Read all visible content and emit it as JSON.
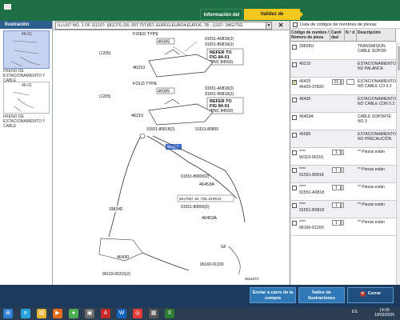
{
  "topbar": {
    "tab_info": "Información del",
    "tab_validity": "Validez de especificación"
  },
  "left": {
    "header": "Ilustración",
    "thumbs": [
      {
        "num": "46-01",
        "caption": "FRENO DE ESTACIONAMIENTO Y CABLE"
      },
      {
        "num": "46-01",
        "caption": "FRENO DE ESTACIONAMIENTO Y CABLE"
      }
    ]
  },
  "middle": {
    "caption": "ILLUST NO. 1 OF 2(1107- )[KZJ70,J20..65T,75T,85T..EURO3,EURO4,EURO6..TB ; (1107- )WG/70G",
    "dropdown": "▼",
    "close": "✕",
    "diagram": {
      "fixed_type": "FIXED TYPE",
      "fold_type": "FOLD TYPE",
      "p46585": "46585",
      "p46585b": "46585",
      "p91551a": "91551-A0818(2)",
      "p91551b": "91551-B0818(2)",
      "p91551c": "91551-A0818(2)",
      "p91551d": "91551-B0818(2)",
      "refer": "REFER TO",
      "fig": "FIG 84-01",
      "pnc": "(PNC 84550)",
      "p46210a": "46210",
      "p46210b": "46210",
      "note1": "(1205)",
      "note2": "(1205)",
      "p91551e": "91551-80818(2)",
      "p91151": "91151-80800",
      "p46420": "46420",
      "p91551f": "91551-80800(2)",
      "p46453": "46453A",
      "wu": "WU7067..B/..T30..EURO4",
      "p91551g": "91551-80800(2)",
      "p46453b": "46453A",
      "p3382": "33824D",
      "p46430": "46430",
      "gf": "GF",
      "p90119": "90119-06315(2)",
      "p96160": "96160-01200",
      "fig_id": "461107C"
    }
  },
  "right": {
    "title": "Lista de códigos de nombres de piezas",
    "headers": {
      "code": "Código de nombre / Número de pieza",
      "qty": "Canti dad",
      "no": "N.º d",
      "desc": "Descripción"
    },
    "rows": [
      {
        "code": "33828U",
        "num": "",
        "qty": "",
        "desc": "TRANSMISIÓN CABLE SOPOR",
        "checked": false
      },
      {
        "code": "46210",
        "num": "",
        "qty": "",
        "desc": "ESTACIONAMIENTO NO PALANCA",
        "checked": false
      },
      {
        "code": "46420",
        "num": "46420-37830",
        "qty": "01",
        "desc": "ESTACIONAMIENTO NO CABLE CO 0.2",
        "checked": true
      },
      {
        "code": "46430",
        "num": "",
        "qty": "",
        "desc": "ESTACIONAMIENTO NO CABLE CON 0.3",
        "checked": false
      },
      {
        "code": "46453A",
        "num": "",
        "qty": "",
        "desc": "CABLE SOPORTE NO 3",
        "checked": false
      },
      {
        "code": "46585",
        "num": "",
        "qty": "",
        "desc": "ESTACIONAMIENTO NO PRECAUCIÓN",
        "checked": false
      },
      {
        "code": "****",
        "num": "90119-06315",
        "qty": "1",
        "desc": "** Piezas están",
        "checked": false
      },
      {
        "code": "****",
        "num": "91551-80818",
        "qty": "1",
        "desc": "** Piezas están",
        "checked": false
      },
      {
        "code": "****",
        "num": "91551-A0818",
        "qty": "1",
        "desc": "** Piezas están",
        "checked": false
      },
      {
        "code": "****",
        "num": "91551-B0818",
        "qty": "1",
        "desc": "** Piezas están",
        "checked": false
      },
      {
        "code": "****",
        "num": "96160-01200",
        "qty": "1",
        "desc": "** Piezas están",
        "checked": false
      }
    ]
  },
  "bottom": {
    "cart": "Enviar a carro de la compra",
    "index": "Índice de ilustraciones",
    "close": "Cerrar"
  },
  "taskbar": {
    "lang": "ES",
    "time": "14:09",
    "date": "10/02/2025"
  }
}
